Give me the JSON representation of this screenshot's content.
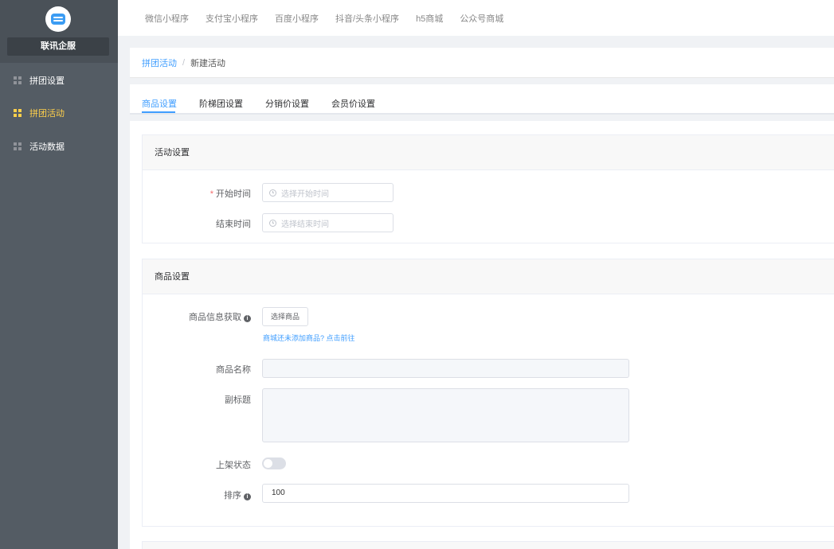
{
  "sidebar": {
    "company": "联讯企服",
    "items": [
      {
        "label": "拼团设置"
      },
      {
        "label": "拼团活动"
      },
      {
        "label": "活动数据"
      }
    ]
  },
  "topnav": {
    "items": [
      "微信小程序",
      "支付宝小程序",
      "百度小程序",
      "抖音/头条小程序",
      "h5商城",
      "公众号商城"
    ]
  },
  "breadcrumb": {
    "parent": "拼团活动",
    "separator": "/",
    "current": "新建活动"
  },
  "tabs": [
    "商品设置",
    "阶梯团设置",
    "分销价设置",
    "会员价设置"
  ],
  "activity_section": {
    "title": "活动设置",
    "start_label": "开始时间",
    "start_required": "*",
    "start_placeholder": "选择开始时间",
    "end_label": "结束时间",
    "end_placeholder": "选择结束时间"
  },
  "goods_section": {
    "title": "商品设置",
    "fetch_label": "商品信息获取",
    "info_icon": "i",
    "select_button": "选择商品",
    "hint_text": "商城还未添加商品?",
    "hint_link": "点击前往",
    "name_label": "商品名称",
    "name_value": "",
    "subtitle_label": "副标题",
    "status_label": "上架状态",
    "status_on": false,
    "sort_label": "排序",
    "sort_value": "100"
  },
  "colors": {
    "accent": "#409eff",
    "sidebar_bg": "#545c64",
    "sidebar_active": "#ffd04b"
  }
}
